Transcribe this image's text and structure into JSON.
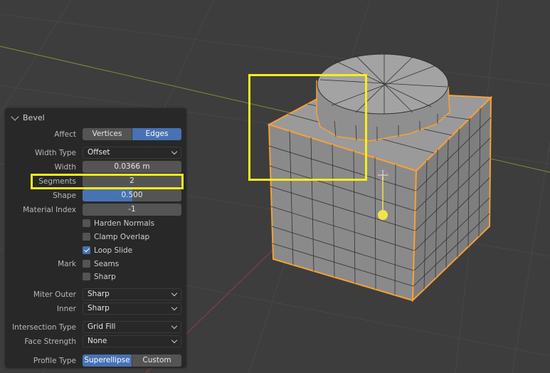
{
  "panel": {
    "title": "Bevel",
    "affect": {
      "label": "Affect",
      "options": [
        "Vertices",
        "Edges"
      ],
      "selected": "Edges"
    },
    "width_type": {
      "label": "Width Type",
      "value": "Offset"
    },
    "width": {
      "label": "Width",
      "value": "0.0366 m"
    },
    "segments": {
      "label": "Segments",
      "value": "2"
    },
    "shape": {
      "label": "Shape",
      "value": "0.500",
      "fraction": 0.5
    },
    "material_index": {
      "label": "Material Index",
      "value": "-1"
    },
    "harden_normals": {
      "label": "Harden Normals",
      "checked": false
    },
    "clamp_overlap": {
      "label": "Clamp Overlap",
      "checked": false
    },
    "loop_slide": {
      "label": "Loop Slide",
      "checked": true
    },
    "mark": {
      "label": "Mark",
      "seams": {
        "label": "Seams",
        "checked": false
      },
      "sharp": {
        "label": "Sharp",
        "checked": false
      }
    },
    "miter_outer": {
      "label": "Miter Outer",
      "value": "Sharp"
    },
    "miter_inner": {
      "label": "Inner",
      "value": "Sharp"
    },
    "intersection_type": {
      "label": "Intersection Type",
      "value": "Grid Fill"
    },
    "face_strength": {
      "label": "Face Strength",
      "value": "None"
    },
    "profile_type": {
      "label": "Profile Type",
      "options": [
        "Superellipse",
        "Custom"
      ],
      "selected": "Superellipse"
    }
  },
  "colors": {
    "accent": "#4772b3",
    "highlight": "#f8ed1b",
    "selected_edge": "#f5a13a",
    "mesh_face": "#8b8b8b",
    "viewport_bg": "#3d3d3d"
  }
}
